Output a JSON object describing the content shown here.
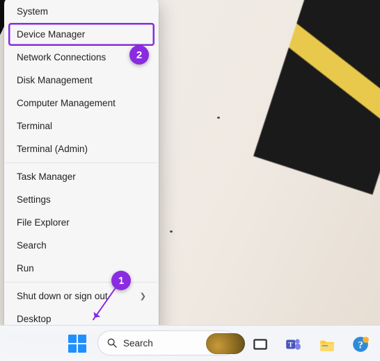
{
  "menu": {
    "items": [
      {
        "label": "System"
      },
      {
        "label": "Device Manager",
        "highlight": true
      },
      {
        "label": "Network Connections"
      },
      {
        "label": "Disk Management"
      },
      {
        "label": "Computer Management"
      },
      {
        "label": "Terminal"
      },
      {
        "label": "Terminal (Admin)"
      }
    ],
    "items2": [
      {
        "label": "Task Manager"
      },
      {
        "label": "Settings"
      },
      {
        "label": "File Explorer"
      },
      {
        "label": "Search"
      },
      {
        "label": "Run"
      }
    ],
    "items3": [
      {
        "label": "Shut down or sign out",
        "submenu": true
      },
      {
        "label": "Desktop"
      }
    ]
  },
  "taskbar": {
    "search_placeholder": "Search"
  },
  "annotations": {
    "badge1": "1",
    "badge2": "2"
  },
  "colors": {
    "accent": "#8a2be2",
    "win_blue": "#1e90ff"
  }
}
